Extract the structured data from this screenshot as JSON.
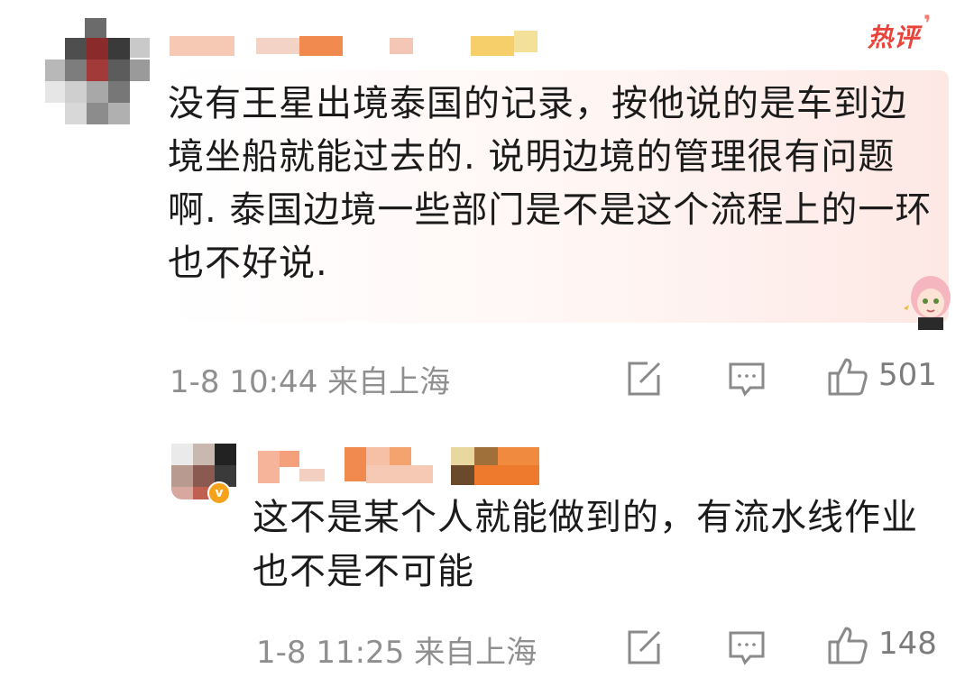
{
  "main_comment": {
    "badge": "热评",
    "text": "没有王星出境泰国的记录，按他说的是车到边境坐船就能过去的. 说明边境的管理很有问题啊. 泰国边境一些部门是不是这个流程上的一环也不好说.",
    "datetime": "1-8 10:44",
    "location": "来自上海",
    "like_count": "501",
    "share_icon": "share-icon",
    "reply_icon": "comment-icon",
    "like_icon": "thumbs-up-icon"
  },
  "reply": {
    "text": "这不是某个人就能做到的，有流水线作业也不是不可能",
    "datetime": "1-8 11:25",
    "location": "来自上海",
    "like_count": "148",
    "share_icon": "share-icon",
    "reply_icon": "comment-icon",
    "like_icon": "thumbs-up-icon"
  },
  "colors": {
    "hot_badge": "#e8443c",
    "meta_text": "#8f8f8f",
    "body_text": "#1b1b1b",
    "highlight_bg": "#fde8e4"
  }
}
